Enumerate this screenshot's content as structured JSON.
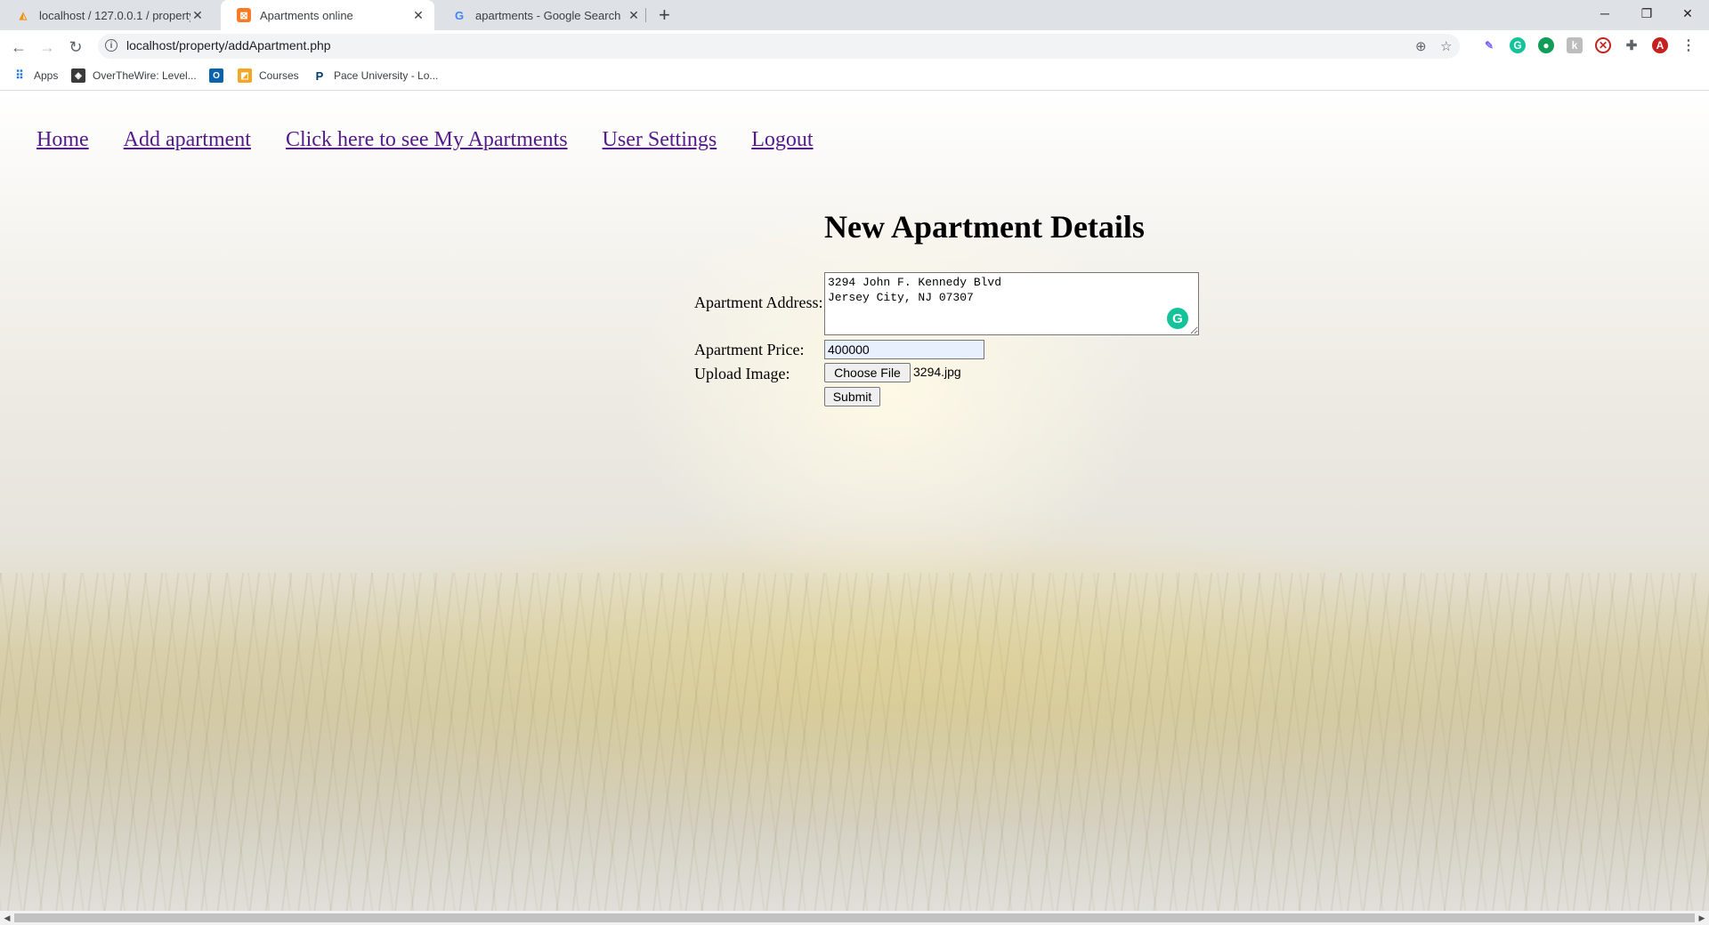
{
  "browser": {
    "tabs": [
      {
        "title": "localhost / 127.0.0.1 / property /",
        "active": false,
        "favicon": "phpmyadmin-icon"
      },
      {
        "title": "Apartments online",
        "active": true,
        "favicon": "xampp-icon"
      },
      {
        "title": "apartments - Google Search",
        "active": false,
        "favicon": "google-icon"
      }
    ],
    "url": "localhost/property/addApartment.php",
    "bookmarks": [
      {
        "label": "Apps"
      },
      {
        "label": "OverTheWire: Level..."
      },
      {
        "label": ""
      },
      {
        "label": "Courses"
      },
      {
        "label": "Pace University - Lo..."
      }
    ],
    "profile_initial": "A"
  },
  "nav": {
    "home": "Home",
    "add_apartment": "Add apartment",
    "my_apartments": "Click here to see My Apartments",
    "user_settings": "User Settings",
    "logout": "Logout"
  },
  "form": {
    "heading": "New Apartment Details",
    "address_label": "Apartment Address:",
    "address_value": "3294 John F. Kennedy Blvd\nJersey City, NJ 07307",
    "price_label": "Apartment Price:",
    "price_value": "400000",
    "image_label": "Upload Image:",
    "choose_file_label": "Choose File",
    "file_name": "3294.jpg",
    "submit_label": "Submit"
  },
  "colors": {
    "link_visited": "#551a8b",
    "grammarly": "#15c39a",
    "profile": "#c5221f"
  }
}
